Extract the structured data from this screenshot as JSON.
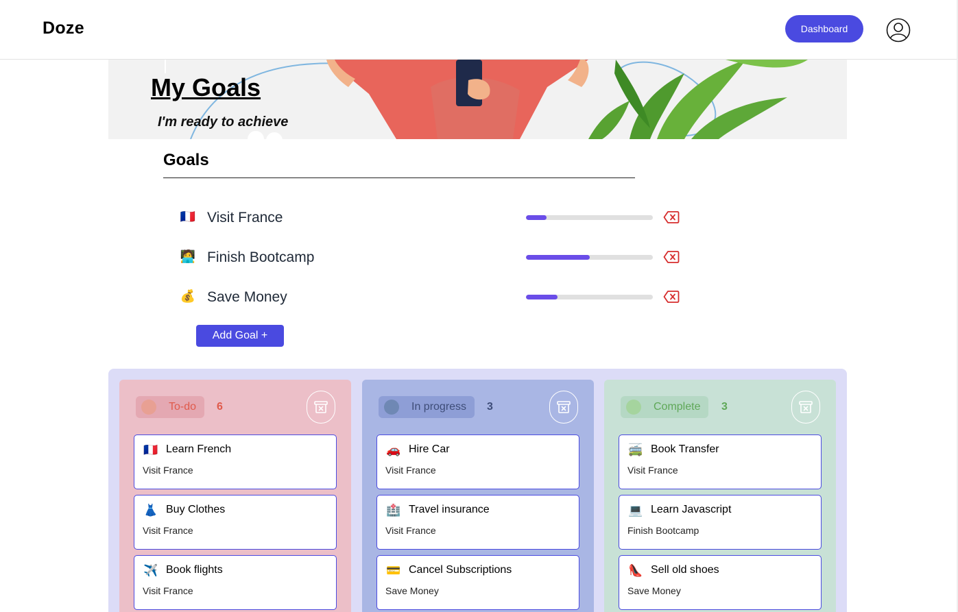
{
  "nav": {
    "brand": "Doze",
    "dashboard_label": "Dashboard",
    "avatar_icon": "user-circle-icon"
  },
  "hero": {
    "title": "My Goals",
    "subtitle": "I'm ready to achieve"
  },
  "goals": {
    "heading": "Goals",
    "items": [
      {
        "emoji": "🇫🇷",
        "label": "Visit France",
        "progress": 0.16
      },
      {
        "emoji": "🧑‍💻",
        "label": "Finish Bootcamp",
        "progress": 0.5
      },
      {
        "emoji": "💰",
        "label": "Save Money",
        "progress": 0.25
      }
    ],
    "delete_icon": "backspace-x-icon",
    "add_label": "Add Goal +"
  },
  "board": {
    "columns": [
      {
        "name": "To-do",
        "count": "6",
        "bg": "#ecbfc8",
        "pill": "#e4a8b2",
        "dot": "#e8a093",
        "text": "#e05a4b",
        "cards": [
          {
            "emoji": "🇫🇷",
            "title": "Learn French",
            "goal": "Visit France"
          },
          {
            "emoji": "👗",
            "title": "Buy Clothes",
            "goal": "Visit France"
          },
          {
            "emoji": "✈️",
            "title": "Book flights",
            "goal": "Visit France"
          }
        ]
      },
      {
        "name": "In progress",
        "count": "3",
        "bg": "#a9b6e4",
        "pill": "#8e9ed6",
        "dot": "#6f88b4",
        "text": "#3e4d78",
        "cards": [
          {
            "emoji": "🚗",
            "title": "Hire Car",
            "goal": "Visit France"
          },
          {
            "emoji": "🏥",
            "title": "Travel insurance",
            "goal": "Visit France"
          },
          {
            "emoji": "💳",
            "title": "Cancel Subscriptions",
            "goal": "Save Money"
          }
        ]
      },
      {
        "name": "Complete",
        "count": "3",
        "bg": "#c8e1d6",
        "pill": "#b5d8c4",
        "dot": "#a5d49e",
        "text": "#5fa858",
        "cards": [
          {
            "emoji": "🚎",
            "title": "Book Transfer",
            "goal": "Visit France"
          },
          {
            "emoji": "💻",
            "title": "Learn Javascript",
            "goal": "Finish Bootcamp"
          },
          {
            "emoji": "👠",
            "title": "Sell old shoes",
            "goal": "Save Money"
          }
        ]
      }
    ],
    "trash_icon": "archive-x-icon"
  }
}
